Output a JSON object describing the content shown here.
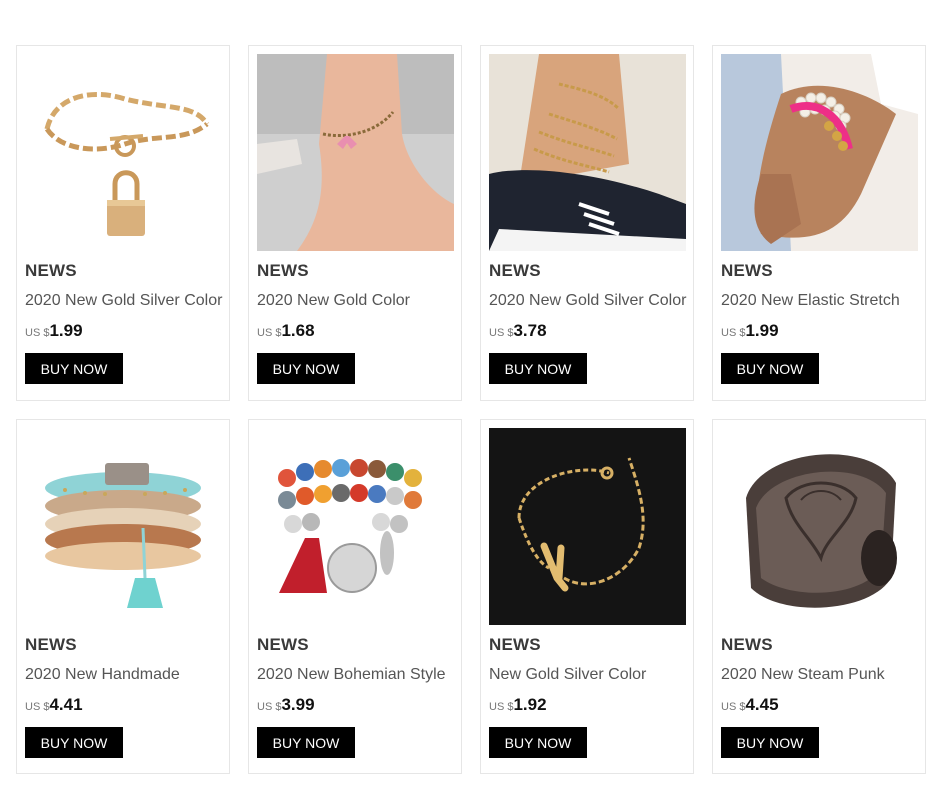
{
  "products": [
    {
      "tag": "NEWS",
      "title": "2020 New Gold Silver Color",
      "currency": "US $",
      "price": "1.99",
      "button": "BUY NOW",
      "image": "gold-chain-padlock-bracelet"
    },
    {
      "tag": "NEWS",
      "title": "2020 New Gold Color",
      "currency": "US $",
      "price": "1.68",
      "button": "BUY NOW",
      "image": "butterfly-anklet-on-foot"
    },
    {
      "tag": "NEWS",
      "title": "2020 New Gold Silver Color",
      "currency": "US $",
      "price": "3.78",
      "button": "BUY NOW",
      "image": "layered-gold-anklets-sneaker"
    },
    {
      "tag": "NEWS",
      "title": "2020 New Elastic Stretch",
      "currency": "US $",
      "price": "1.99",
      "button": "BUY NOW",
      "image": "pearl-pink-bracelet-wrist"
    },
    {
      "tag": "NEWS",
      "title": "2020 New Handmade",
      "currency": "US $",
      "price": "4.41",
      "button": "BUY NOW",
      "image": "turquoise-tassel-leather-bracelet"
    },
    {
      "tag": "NEWS",
      "title": "2020 New Bohemian Style",
      "currency": "US $",
      "price": "3.99",
      "button": "BUY NOW",
      "image": "bohemian-bead-bracelet-tassel"
    },
    {
      "tag": "NEWS",
      "title": "New Gold Silver Color",
      "currency": "US $",
      "price": "1.92",
      "button": "BUY NOW",
      "image": "letter-y-gold-chain-bracelet"
    },
    {
      "tag": "NEWS",
      "title": "2020 New Steam Punk",
      "currency": "US $",
      "price": "4.45",
      "button": "BUY NOW",
      "image": "embossed-leather-cuff"
    }
  ]
}
